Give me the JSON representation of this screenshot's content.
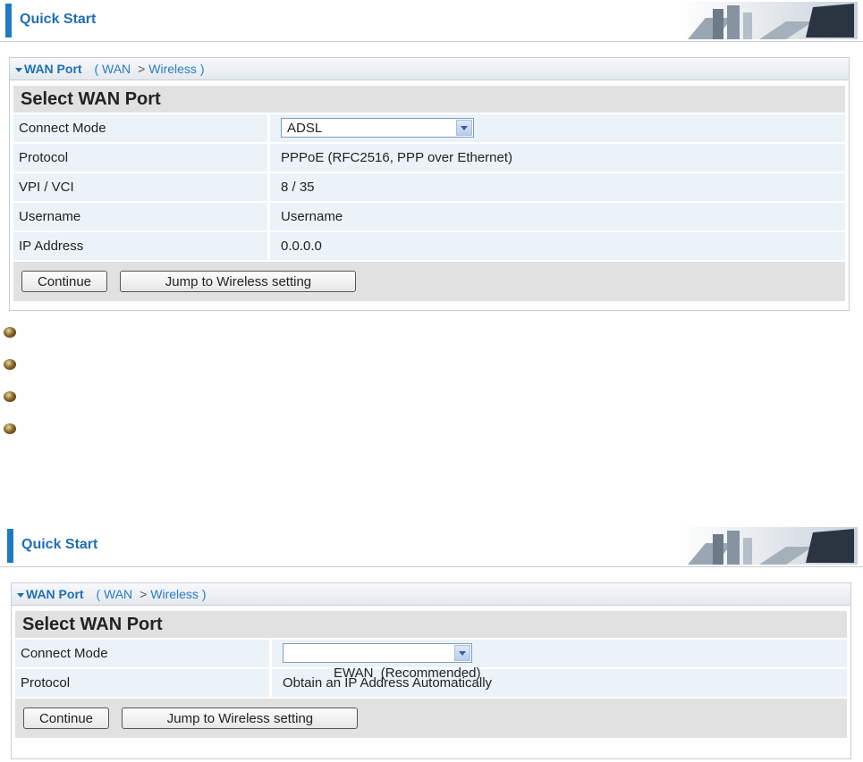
{
  "colors": {
    "accent": "#1d7bc2",
    "link": "#1f6fb4",
    "row_bg": "#ebf2f8",
    "section_bg": "#e1e1e1"
  },
  "panel1": {
    "header": {
      "title": "Quick Start"
    },
    "breadcrumb": {
      "root": "WAN Port",
      "open": "(",
      "step1": "WAN",
      "sep": ">",
      "step2": "Wireless",
      "close": ")"
    },
    "section_title": "Select WAN Port",
    "rows": [
      {
        "label": "Connect Mode",
        "value": "ADSL"
      },
      {
        "label": "Protocol",
        "value": "PPPoE (RFC2516, PPP over Ethernet)"
      },
      {
        "label": "VPI / VCI",
        "value": "8 / 35"
      },
      {
        "label": "Username",
        "value": "Username"
      },
      {
        "label": "IP Address",
        "value": "0.0.0.0"
      }
    ],
    "buttons": {
      "continue": "Continue",
      "jump": "Jump to Wireless setting"
    }
  },
  "panel2": {
    "header": {
      "title": "Quick Start"
    },
    "breadcrumb": {
      "root": "WAN Port",
      "open": "(",
      "step1": "WAN",
      "sep": ">",
      "step2": "Wireless",
      "close": ")"
    },
    "section_title": "Select WAN Port",
    "rows": [
      {
        "label": "Connect Mode",
        "value": "EWAN  (Recommended)"
      },
      {
        "label": "Protocol",
        "value": "Obtain an IP Address Automatically"
      }
    ],
    "buttons": {
      "continue": "Continue",
      "jump": "Jump to Wireless setting"
    }
  },
  "bullets": {
    "count": 4,
    "icon": "bronze-bullet-icon"
  }
}
